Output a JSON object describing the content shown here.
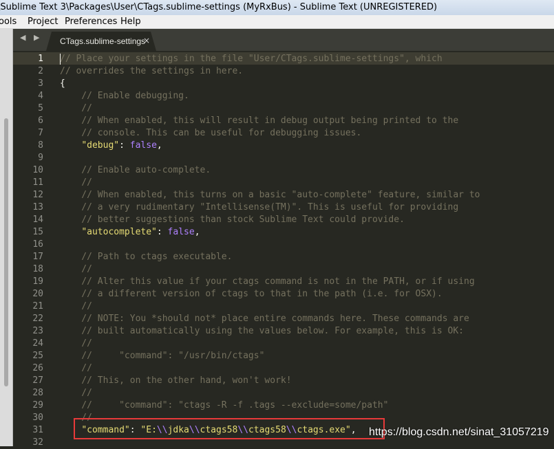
{
  "window": {
    "title": "\\Sublime Text 3\\Packages\\User\\CTags.sublime-settings (MyRxBus) - Sublime Text (UNREGISTERED)"
  },
  "menubar": {
    "items": [
      {
        "label": "ools"
      },
      {
        "label": "Project"
      },
      {
        "label": "Preferences"
      },
      {
        "label": "Help"
      }
    ]
  },
  "tabbar": {
    "nav_arrows": "◀ ▶",
    "tab_label": "CTags.sublime-settings",
    "close_glyph": "×"
  },
  "editor": {
    "line_numbers": [
      "1",
      "2",
      "3",
      "4",
      "5",
      "6",
      "7",
      "8",
      "9",
      "10",
      "11",
      "12",
      "13",
      "14",
      "15",
      "16",
      "17",
      "18",
      "19",
      "20",
      "21",
      "22",
      "23",
      "24",
      "25",
      "26",
      "27",
      "28",
      "29",
      "30",
      "31",
      "32"
    ],
    "lines": [
      [
        {
          "t": "// Place your settings in the file \"User/CTags.sublime-settings\", which",
          "c": "c"
        }
      ],
      [
        {
          "t": "// overrides the settings in here.",
          "c": "c"
        }
      ],
      [
        {
          "t": "{",
          "c": "p"
        }
      ],
      [
        {
          "t": "    // Enable debugging.",
          "c": "c"
        }
      ],
      [
        {
          "t": "    //",
          "c": "c"
        }
      ],
      [
        {
          "t": "    // When enabled, this will result in debug output being printed to the",
          "c": "c"
        }
      ],
      [
        {
          "t": "    // console. This can be useful for debugging issues.",
          "c": "c"
        }
      ],
      [
        {
          "t": "    ",
          "c": "p"
        },
        {
          "t": "\"debug\"",
          "c": "s"
        },
        {
          "t": ": ",
          "c": "p"
        },
        {
          "t": "false",
          "c": "k"
        },
        {
          "t": ",",
          "c": "p"
        }
      ],
      [
        {
          "t": "",
          "c": "p"
        }
      ],
      [
        {
          "t": "    // Enable auto-complete.",
          "c": "c"
        }
      ],
      [
        {
          "t": "    //",
          "c": "c"
        }
      ],
      [
        {
          "t": "    // When enabled, this turns on a basic \"auto-complete\" feature, similar to",
          "c": "c"
        }
      ],
      [
        {
          "t": "    // a very rudimentary \"Intellisense(TM)\". This is useful for providing",
          "c": "c"
        }
      ],
      [
        {
          "t": "    // better suggestions than stock Sublime Text could provide.",
          "c": "c"
        }
      ],
      [
        {
          "t": "    ",
          "c": "p"
        },
        {
          "t": "\"autocomplete\"",
          "c": "s"
        },
        {
          "t": ": ",
          "c": "p"
        },
        {
          "t": "false",
          "c": "k"
        },
        {
          "t": ",",
          "c": "p"
        }
      ],
      [
        {
          "t": "",
          "c": "p"
        }
      ],
      [
        {
          "t": "    // Path to ctags executable.",
          "c": "c"
        }
      ],
      [
        {
          "t": "    //",
          "c": "c"
        }
      ],
      [
        {
          "t": "    // Alter this value if your ctags command is not in the PATH, or if using",
          "c": "c"
        }
      ],
      [
        {
          "t": "    // a different version of ctags to that in the path (i.e. for OSX).",
          "c": "c"
        }
      ],
      [
        {
          "t": "    //",
          "c": "c"
        }
      ],
      [
        {
          "t": "    // NOTE: You *should not* place entire commands here. These commands are",
          "c": "c"
        }
      ],
      [
        {
          "t": "    // built automatically using the values below. For example, this is OK:",
          "c": "c"
        }
      ],
      [
        {
          "t": "    //",
          "c": "c"
        }
      ],
      [
        {
          "t": "    //     \"command\": \"/usr/bin/ctags\"",
          "c": "c"
        }
      ],
      [
        {
          "t": "    //",
          "c": "c"
        }
      ],
      [
        {
          "t": "    // This, on the other hand, won't work!",
          "c": "c"
        }
      ],
      [
        {
          "t": "    //",
          "c": "c"
        }
      ],
      [
        {
          "t": "    //     \"command\": \"ctags -R -f .tags --exclude=some/path\"",
          "c": "c"
        }
      ],
      [
        {
          "t": "    //",
          "c": "c"
        }
      ],
      [
        {
          "t": "    ",
          "c": "p"
        },
        {
          "t": "\"command\"",
          "c": "s"
        },
        {
          "t": ": ",
          "c": "p"
        },
        {
          "t": "\"E:",
          "c": "s"
        },
        {
          "t": "\\\\",
          "c": "k"
        },
        {
          "t": "jdka",
          "c": "s"
        },
        {
          "t": "\\\\",
          "c": "k"
        },
        {
          "t": "ctags58",
          "c": "s"
        },
        {
          "t": "\\\\",
          "c": "k"
        },
        {
          "t": "ctags58",
          "c": "s"
        },
        {
          "t": "\\\\",
          "c": "k"
        },
        {
          "t": "ctags.exe\"",
          "c": "s"
        },
        {
          "t": ",",
          "c": "p"
        }
      ],
      [
        {
          "t": "",
          "c": "p"
        }
      ]
    ]
  },
  "watermark": "https://blog.csdn.net/sinat_31057219",
  "colors": {
    "background": "#272822",
    "comment": "#75715e",
    "string": "#e6db74",
    "constant": "#ae81ff",
    "highlight_box": "#e83a3a"
  }
}
